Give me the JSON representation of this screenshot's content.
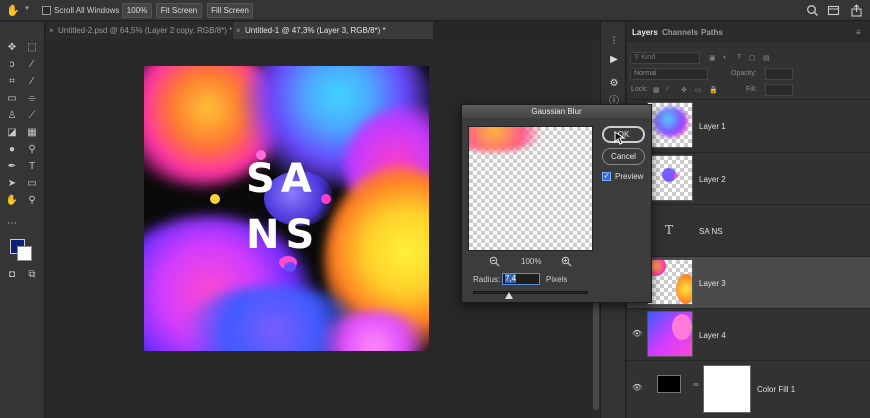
{
  "options_bar": {
    "scroll_all_windows": "Scroll All Windows",
    "zoom_100": "100%",
    "fit_screen": "Fit Screen",
    "fill_screen": "Fill Screen"
  },
  "tabs": [
    {
      "label": "Untitled-2.psd @ 64,5% (Layer 2 copy, RGB/8*) *",
      "close": "×"
    },
    {
      "label": "Untitled-1 @ 47,3% (Layer 3, RGB/8*) *",
      "close": "×"
    }
  ],
  "artwork": {
    "line1": "SA",
    "line2": "NS"
  },
  "dialog": {
    "title": "Gaussian Blur",
    "ok": "OK",
    "cancel": "Cancel",
    "preview_label": "Preview",
    "zoom": "100%",
    "radius_label": "Radius:",
    "radius_value": "7,4",
    "radius_unit": "Pixels"
  },
  "panel": {
    "tabs": [
      "Layers",
      "Channels",
      "Paths"
    ],
    "filter_placeholder": "Kind",
    "blend_mode": "Normal",
    "opacity_label": "Opacity:",
    "lock_label": "Lock:",
    "fill_label": "Fill:",
    "layers": [
      {
        "name": "Layer 1"
      },
      {
        "name": "Layer 2"
      },
      {
        "name": "SA NS",
        "icon": "T"
      },
      {
        "name": "Layer 3"
      },
      {
        "name": "Layer 4"
      },
      {
        "name": "Color Fill 1"
      }
    ]
  },
  "colors": {
    "foreground": "#0c1f7a",
    "background": "#ffffff"
  }
}
